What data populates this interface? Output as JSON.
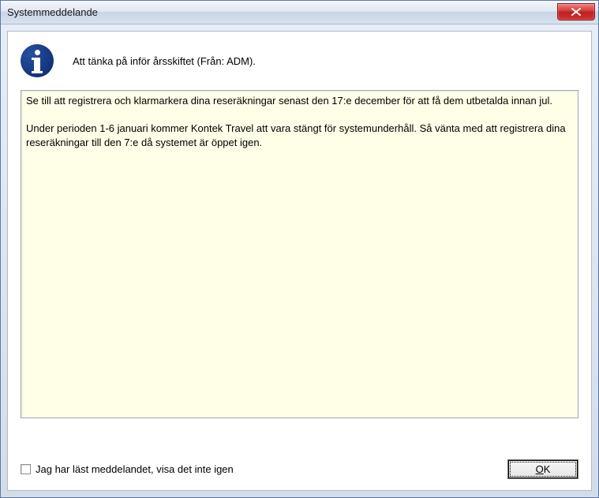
{
  "window": {
    "title": "Systemmeddelande"
  },
  "header": {
    "message_title": "Att tänka på inför årsskiftet (Från: ADM)."
  },
  "body": {
    "text": "Se till att registrera och klarmarkera dina reseräkningar senast den 17:e december för att få dem utbetalda innan jul.\n\nUnder perioden 1-6 januari kommer Kontek Travel att vara stängt för systemunderhåll. Så vänta med att registrera dina reseräkningar till den 7:e då systemet är öppet igen."
  },
  "footer": {
    "checkbox_label": "Jag har läst meddelandet, visa det inte igen",
    "checkbox_checked": false,
    "ok_underline": "O",
    "ok_rest": "K"
  },
  "icons": {
    "info": "info-icon",
    "close": "close-icon"
  },
  "colors": {
    "body_bg": "#ffffe8",
    "titlebar_text": "#1a1a1a",
    "close_red": "#c02020",
    "info_blue": "#0a2868"
  }
}
